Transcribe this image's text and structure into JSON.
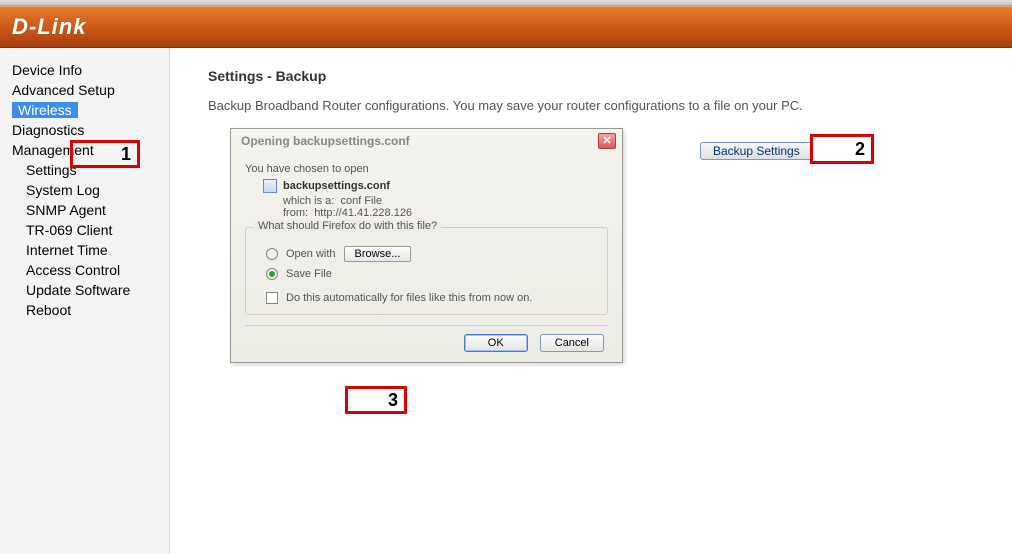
{
  "brand": "D-Link",
  "nav": {
    "device_info": "Device Info",
    "advanced_setup": "Advanced Setup",
    "wireless": "Wireless",
    "diagnostics": "Diagnostics",
    "management": "Management",
    "sub": {
      "settings": "Settings",
      "system_log": "System Log",
      "snmp_agent": "SNMP Agent",
      "tr069": "TR-069 Client",
      "internet_time": "Internet Time",
      "access_control": "Access Control",
      "update_software": "Update Software",
      "reboot": "Reboot"
    }
  },
  "page": {
    "title": "Settings - Backup",
    "desc": "Backup Broadband Router configurations. You may save your router configurations to a file on your PC.",
    "backup_btn": "Backup Settings"
  },
  "callouts": {
    "c1": "1",
    "c2": "2",
    "c3": "3"
  },
  "dialog": {
    "title": "Opening backupsettings.conf",
    "chosen": "You have chosen to open",
    "filename": "backupsettings.conf",
    "which_label": "which is a:",
    "which_value": "conf File",
    "from_label": "from:",
    "from_value": "http://41.41.228.126",
    "question": "What should Firefox do with this file?",
    "open_with": "Open with",
    "browse": "Browse...",
    "save_file": "Save File",
    "auto": "Do this automatically for files like this from now on.",
    "ok": "OK",
    "cancel": "Cancel"
  }
}
